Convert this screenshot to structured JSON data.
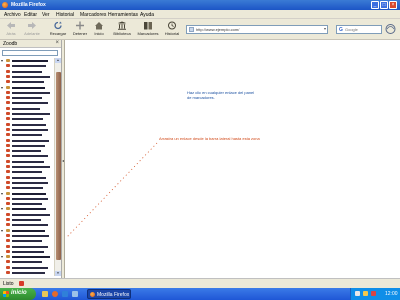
{
  "window": {
    "title": "Mozilla Firefox",
    "controls": {
      "minimize": "_",
      "maximize": "□",
      "close": "×"
    }
  },
  "menu": [
    "Archivo",
    "Editar",
    "Ver",
    "Historial",
    "Marcadores",
    "Herramientas",
    "Ayuda"
  ],
  "toolbar": {
    "back": "Atrás",
    "forward": "Adelante",
    "reload": "Recargar",
    "stop": "Detener",
    "home": "Inicio",
    "library": "Biblioteca",
    "bookmarks": "Marcadores",
    "history": "Historial"
  },
  "urlbar": {
    "value": "http://www.ejemplo.com/"
  },
  "search": {
    "placeholder": "Google",
    "engine_glyph": "G"
  },
  "sidebar": {
    "title": "Zoodb",
    "close": "×",
    "rows": [
      {
        "type": "folder",
        "line": 36
      },
      {
        "type": "item",
        "line": 34
      },
      {
        "type": "item",
        "line": 30
      },
      {
        "type": "item",
        "line": 38
      },
      {
        "type": "item",
        "line": 32
      },
      {
        "type": "folder",
        "line": 33
      },
      {
        "type": "item",
        "line": 38
      },
      {
        "type": "item",
        "line": 30
      },
      {
        "type": "item",
        "line": 36
      },
      {
        "type": "item",
        "line": 28
      },
      {
        "type": "item",
        "line": 38
      },
      {
        "type": "item",
        "line": 31
      },
      {
        "type": "item",
        "line": 34
      },
      {
        "type": "item",
        "line": 36
      },
      {
        "type": "item",
        "line": 30
      },
      {
        "type": "item",
        "line": 37
      },
      {
        "type": "item",
        "line": 33
      },
      {
        "type": "item",
        "line": 29
      },
      {
        "type": "item",
        "line": 36
      },
      {
        "type": "item",
        "line": 32
      },
      {
        "type": "item",
        "line": 38
      },
      {
        "type": "item",
        "line": 30
      },
      {
        "type": "item",
        "line": 34
      },
      {
        "type": "item",
        "line": 36
      },
      {
        "type": "item",
        "line": 31
      },
      {
        "type": "folder",
        "line": 34
      },
      {
        "type": "item",
        "line": 36
      },
      {
        "type": "item",
        "line": 30
      },
      {
        "type": "folder",
        "line": 34
      },
      {
        "type": "item",
        "line": 38
      },
      {
        "type": "item",
        "line": 29
      },
      {
        "type": "item",
        "line": 36
      },
      {
        "type": "folder",
        "line": 33
      },
      {
        "type": "item",
        "line": 37
      },
      {
        "type": "item",
        "line": 30
      },
      {
        "type": "item",
        "line": 36
      },
      {
        "type": "item",
        "line": 32
      },
      {
        "type": "folder",
        "line": 38
      },
      {
        "type": "item",
        "line": 30
      },
      {
        "type": "item",
        "line": 36
      },
      {
        "type": "item",
        "line": 33
      }
    ]
  },
  "content": {
    "message_lines": [
      "Haz clic en cualquier enlace del panel",
      "de marcadores."
    ],
    "hint": "Arrastra un enlace desde la barra lateral hasta esta zona"
  },
  "status": {
    "text": "Listo"
  },
  "taskbar": {
    "start": "inicio",
    "task": "Mozilla Firefox",
    "clock": "12:00"
  },
  "colors": {
    "titlebar": "#1c55c6",
    "chrome": "#ece9d8",
    "message_link": "#1a4fa0",
    "hint": "#d14a1a",
    "folder_icon": "#c8923a",
    "item_icon": "#d04a2a"
  }
}
